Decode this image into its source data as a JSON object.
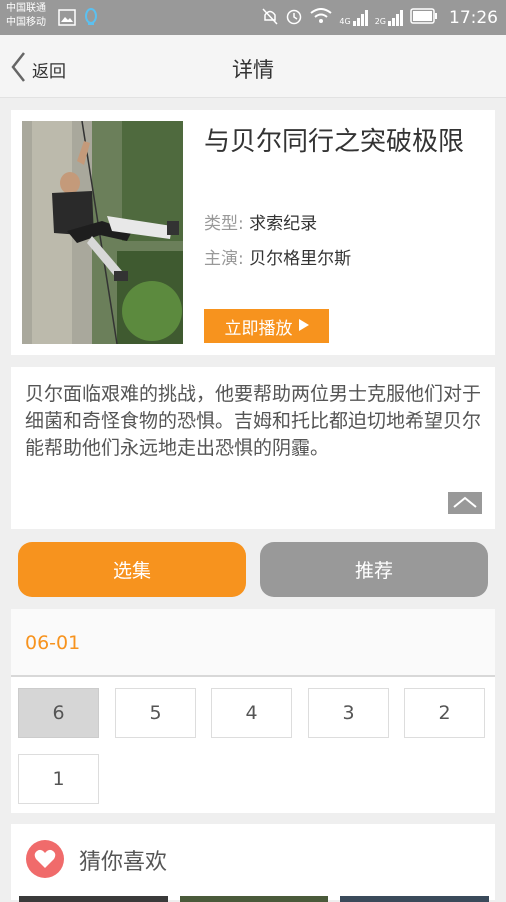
{
  "status_bar": {
    "carrier_1": "中国联通",
    "carrier_2": "中国移动",
    "net_4g": "4G",
    "net_2g": "2G",
    "time": "17:26"
  },
  "nav": {
    "back_label": "返回",
    "title": "详情"
  },
  "show": {
    "title": "与贝尔同行之突破极限",
    "type_label": "类型:",
    "type_value": "求索纪录",
    "cast_label": "主演:",
    "cast_value": "贝尔格里尔斯",
    "play_label": "立即播放"
  },
  "description": {
    "text": "贝尔面临艰难的挑战，他要帮助两位男士克服他们对于细菌和奇怪食物的恐惧。吉姆和托比都迫切地希望贝尔能帮助他们永远地走出恐惧的阴霾。"
  },
  "tabs": {
    "episodes": "选集",
    "recommend": "推荐"
  },
  "season": {
    "label": "06-01"
  },
  "episodes": [
    "6",
    "5",
    "4",
    "3",
    "2",
    "1"
  ],
  "guess": {
    "title": "猜你喜欢"
  },
  "colors": {
    "accent": "#f7931e",
    "inactive_tab": "#999999",
    "heart": "#f06b6b"
  }
}
